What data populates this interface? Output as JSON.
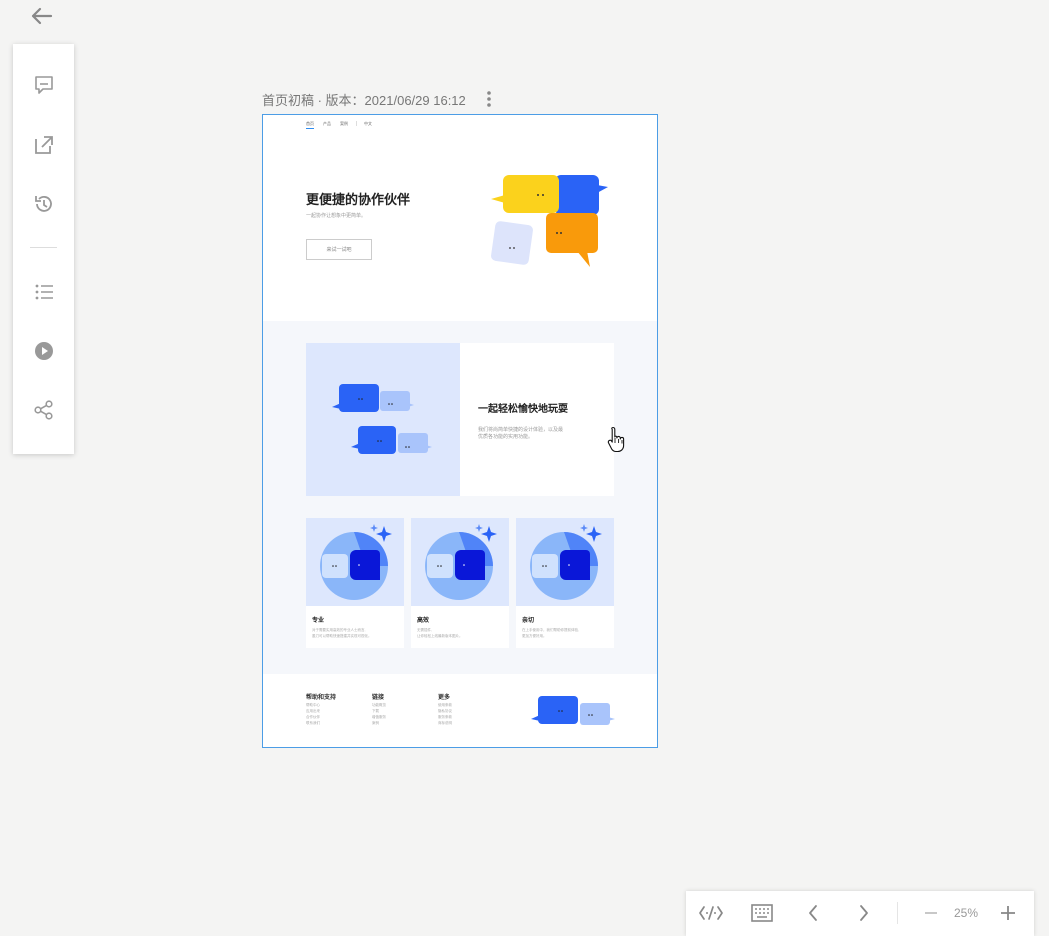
{
  "artboard_title": "首页初稿 · 版本：2021/06/29 16:12",
  "design": {
    "nav": [
      "首页",
      "产品",
      "案例",
      "中文"
    ],
    "hero": {
      "title": "更便捷的协作伙伴",
      "subtitle": "一起协作让想象中更简单。",
      "button": "来试一试吧"
    },
    "feature": {
      "title": "一起轻松愉快地玩耍",
      "desc_line1": "我们将尚简单快捷的设计体验，以及最",
      "desc_line2": "优质各功能的实用功能。"
    },
    "cards": [
      {
        "title": "专业",
        "desc_line1": "对于需要实用高效的专业人士而言,",
        "desc_line2": "墨刀可以帮助快速搭建并实现可视化。"
      },
      {
        "title": "高效",
        "desc_line1": "无需插件,",
        "desc_line2": "让你轻松上线最新版本图片。"
      },
      {
        "title": "亲切",
        "desc_line1": "在上手使用中，我们帮助你提前体验,",
        "desc_line2": "更加方便好用。"
      }
    ],
    "footer": [
      {
        "heading": "帮助和支持",
        "items": [
          "帮助中心",
          "应用出来",
          "合作伙伴",
          "联系我们"
        ]
      },
      {
        "heading": "链接",
        "items": [
          "功能概览",
          "下载",
          "增值服务",
          "案例"
        ]
      },
      {
        "heading": "更多",
        "items": [
          "使用条款",
          "隐私协议",
          "服务条款",
          "商标说明"
        ]
      }
    ]
  },
  "zoom": {
    "level": "25%"
  },
  "colors": {
    "accent": "#2d8cf0",
    "bubble_yellow": "#fbd21c",
    "bubble_blue": "#2a63f6",
    "bubble_orange": "#f99a0b",
    "bubble_light": "#dde4fb"
  },
  "icons": {
    "toolbar": [
      "comment-icon",
      "external-link-icon",
      "history-icon",
      "list-icon",
      "play-icon",
      "share-icon"
    ],
    "zoombar": [
      "code-icon",
      "keyboard-icon",
      "chevron-left-icon",
      "chevron-right-icon",
      "minus-icon",
      "plus-icon"
    ]
  }
}
